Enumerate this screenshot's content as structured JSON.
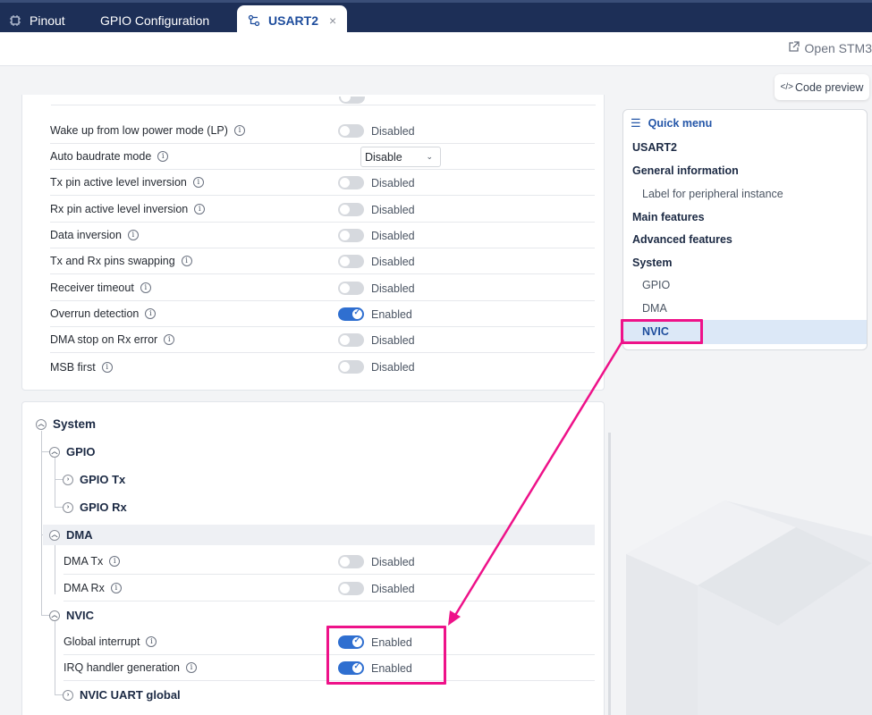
{
  "tabs": [
    {
      "label": "Pinout",
      "icon": "chip-icon"
    },
    {
      "label": "GPIO Configuration"
    },
    {
      "label": "USART2",
      "icon": "peripheral-icon",
      "active": true,
      "close": "×"
    }
  ],
  "toolbar": {
    "open_label": "Open STM3",
    "open_icon": "external-link-icon"
  },
  "code_preview": {
    "icon": "</>",
    "label": "Code preview"
  },
  "advanced_rows": [
    {
      "label": "Wake up from low power mode (LP)",
      "type": "toggle",
      "on": false,
      "state": "Disabled"
    },
    {
      "label": "Auto baudrate mode",
      "type": "select",
      "value": "Disable"
    },
    {
      "label": "Tx pin active level inversion",
      "type": "toggle",
      "on": false,
      "state": "Disabled"
    },
    {
      "label": "Rx pin active level inversion",
      "type": "toggle",
      "on": false,
      "state": "Disabled"
    },
    {
      "label": "Data inversion",
      "type": "toggle",
      "on": false,
      "state": "Disabled"
    },
    {
      "label": "Tx and Rx pins swapping",
      "type": "toggle",
      "on": false,
      "state": "Disabled"
    },
    {
      "label": "Receiver timeout",
      "type": "toggle",
      "on": false,
      "state": "Disabled"
    },
    {
      "label": "Overrun detection",
      "type": "toggle",
      "on": true,
      "state": "Enabled"
    },
    {
      "label": "DMA stop on Rx error",
      "type": "toggle",
      "on": false,
      "state": "Disabled"
    },
    {
      "label": "MSB first",
      "type": "toggle",
      "on": false,
      "state": "Disabled"
    }
  ],
  "system": {
    "title": "System",
    "gpio": {
      "title": "GPIO",
      "tx": "GPIO Tx",
      "rx": "GPIO Rx"
    },
    "dma": {
      "title": "DMA",
      "rows": [
        {
          "label": "DMA Tx",
          "state": "Disabled"
        },
        {
          "label": "DMA Rx",
          "state": "Disabled"
        }
      ]
    },
    "nvic": {
      "title": "NVIC",
      "rows": [
        {
          "label": "Global interrupt",
          "state": "Enabled"
        },
        {
          "label": "IRQ handler generation",
          "state": "Enabled"
        }
      ],
      "uart_global": "NVIC UART global"
    }
  },
  "quick_menu": {
    "title": "Quick menu",
    "items": [
      {
        "label": "USART2",
        "style": "bold"
      },
      {
        "label": "General information",
        "style": "bold"
      },
      {
        "label": "Label for peripheral instance",
        "style": "sub"
      },
      {
        "label": "Main features",
        "style": "bold"
      },
      {
        "label": "Advanced features",
        "style": "bold"
      },
      {
        "label": "System",
        "style": "bold"
      },
      {
        "label": "GPIO",
        "style": "sub"
      },
      {
        "label": "DMA",
        "style": "sub"
      },
      {
        "label": "NVIC",
        "style": "sub-selected"
      }
    ]
  },
  "colors": {
    "brand_navy": "#1d2f57",
    "toggle_on": "#2f6fd0",
    "annotation": "#ee1289",
    "selected_bg": "#dce8f7"
  }
}
